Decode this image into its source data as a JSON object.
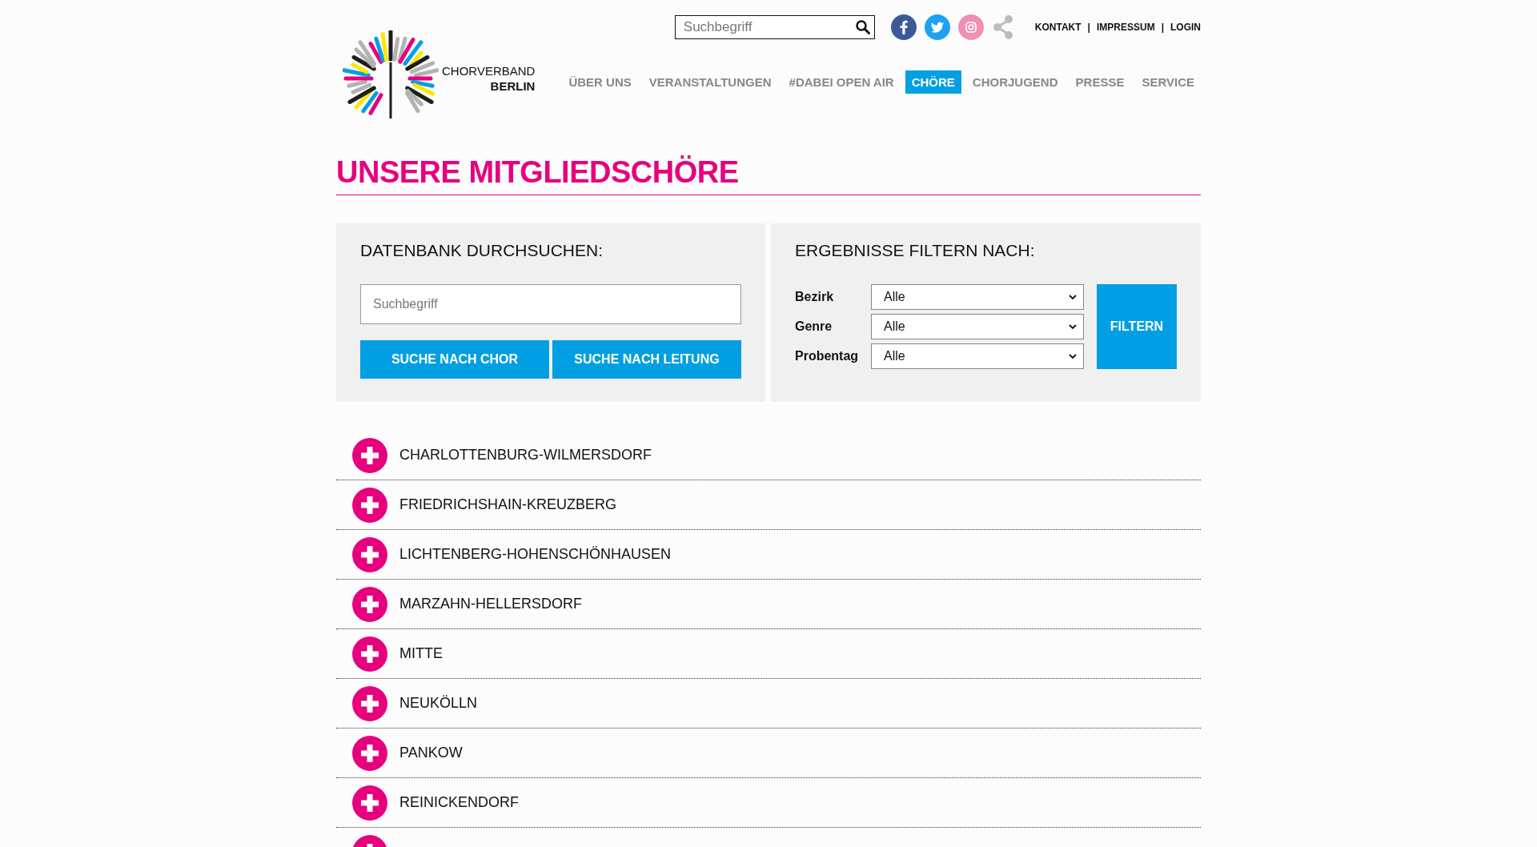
{
  "header": {
    "search": {
      "placeholder": "Suchbegriff"
    },
    "links": [
      "KONTAKT",
      "IMPRESSUM",
      "LOGIN"
    ],
    "separator": "|"
  },
  "logo": {
    "line1": "CHORVERBAND",
    "line2": "BERLIN"
  },
  "nav": [
    {
      "label": "ÜBER UNS",
      "selected": false
    },
    {
      "label": "VERANSTALTUNGEN",
      "selected": false
    },
    {
      "label": "#DABEI OPEN AIR",
      "selected": false
    },
    {
      "label": "CHÖRE",
      "selected": true
    },
    {
      "label": "CHORJUGEND",
      "selected": false
    },
    {
      "label": "PRESSE",
      "selected": false
    },
    {
      "label": "SERVICE",
      "selected": false
    }
  ],
  "page_title": "UNSERE MITGLIEDSCHÖRE",
  "search_panel": {
    "title": "DATENBANK DURCHSUCHEN:",
    "placeholder": "Suchbegriff",
    "buttons": [
      "SUCHE NACH CHOR",
      "SUCHE NACH LEITUNG"
    ]
  },
  "filter_panel": {
    "title": "ERGEBNISSE FILTERN NACH:",
    "filters": [
      {
        "label": "Bezirk",
        "value": "Alle"
      },
      {
        "label": "Genre",
        "value": "Alle"
      },
      {
        "label": "Probentag",
        "value": "Alle"
      }
    ],
    "button": "FILTERN"
  },
  "districts": [
    {
      "label": "CHARLOTTENBURG-WILMERSDORF",
      "expanded": false
    },
    {
      "label": "FRIEDRICHSHAIN-KREUZBERG",
      "expanded": false
    },
    {
      "label": "LICHTENBERG-HOHENSCHÖNHAUSEN",
      "expanded": false
    },
    {
      "label": "MARZAHN-HELLERSDORF",
      "expanded": false
    },
    {
      "label": "MITTE",
      "expanded": false
    },
    {
      "label": "NEUKÖLLN",
      "expanded": false
    },
    {
      "label": "PANKOW",
      "expanded": false
    },
    {
      "label": "REINICKENDORF",
      "expanded": false
    },
    {
      "expanded": false
    }
  ]
}
